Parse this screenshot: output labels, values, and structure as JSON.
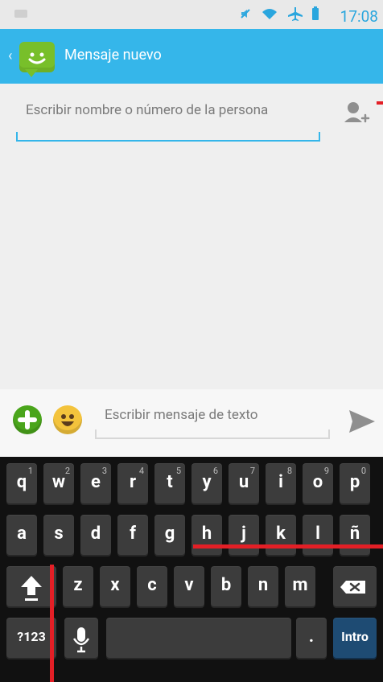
{
  "status": {
    "time": "17:08",
    "icons": [
      "mute-icon",
      "wifi-icon",
      "airplane-icon",
      "battery-icon"
    ]
  },
  "header": {
    "title": "Mensaje nuevo",
    "back_icon": "back-chevron-icon",
    "app_icon": "messaging-app-icon"
  },
  "compose": {
    "to_placeholder": "Escribir nombre o número de la persona",
    "add_contact_icon": "add-contact-icon"
  },
  "message": {
    "placeholder": "Escribir mensaje de texto",
    "attach_icon": "add-attachment-icon",
    "emoji_icon": "emoji-icon",
    "send_icon": "send-icon"
  },
  "keyboard": {
    "row1": [
      {
        "k": "q",
        "n": "1"
      },
      {
        "k": "w",
        "n": "2"
      },
      {
        "k": "e",
        "n": "3"
      },
      {
        "k": "r",
        "n": "4"
      },
      {
        "k": "t",
        "n": "5"
      },
      {
        "k": "y",
        "n": "6"
      },
      {
        "k": "u",
        "n": "7"
      },
      {
        "k": "i",
        "n": "8"
      },
      {
        "k": "o",
        "n": "9"
      },
      {
        "k": "p",
        "n": "0"
      }
    ],
    "row2": [
      "a",
      "s",
      "d",
      "f",
      "g",
      "h",
      "j",
      "k",
      "l",
      "ñ"
    ],
    "row3": [
      "z",
      "x",
      "c",
      "v",
      "b",
      "n",
      "m"
    ],
    "shift_icon": "shift-icon",
    "backspace_icon": "backspace-icon",
    "symbols_label": "?123",
    "mic_icon": "mic-icon",
    "space_label": "",
    "period_label": ".",
    "enter_label": "Intro"
  },
  "colors": {
    "accent": "#35b6ea",
    "status_time": "#29a6de",
    "red_marker": "#e31f26"
  }
}
